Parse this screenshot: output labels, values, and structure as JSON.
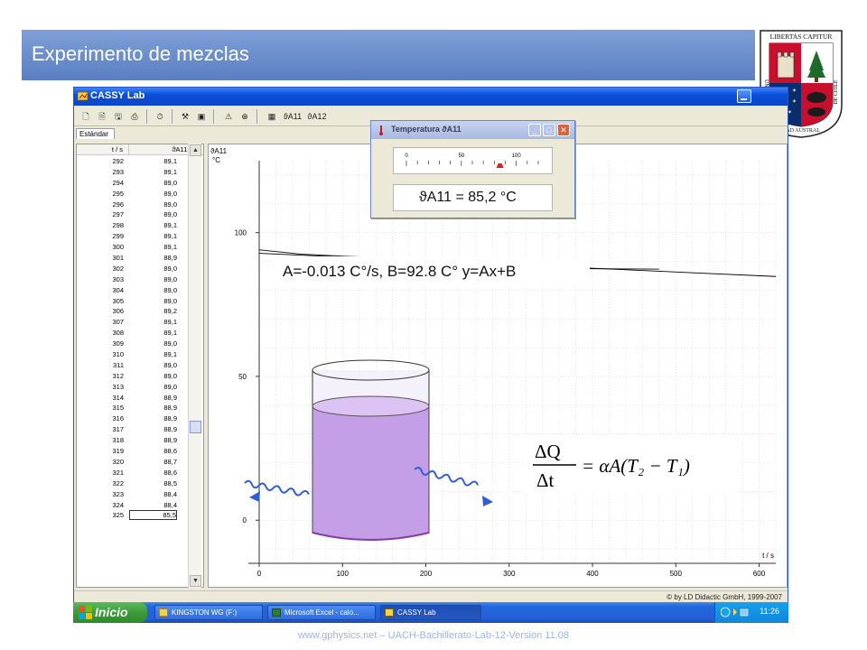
{
  "slide": {
    "title": "Experimento de mezclas",
    "footer": "www.gphysics.net – UACH-Bachillerato-Lab-12-Version 11.08",
    "seal_top_text": "LIBERTAS CAPITUR",
    "seal_left_text": "UNIVERSI",
    "seal_bottom_text": "DAD AUSTRAL",
    "seal_right_text": "DE CHILE"
  },
  "window": {
    "title": "CASSY Lab",
    "tab": "Estándar",
    "status": "© by LD Didactic GmbH, 1999-2007",
    "toolbar": {
      "a11": "ϑA11",
      "a12": "ϑA12"
    }
  },
  "table": {
    "col1": "t / s",
    "col2": "ϑA11 / °C",
    "rows": [
      [
        "292",
        "89,1"
      ],
      [
        "293",
        "89,1"
      ],
      [
        "294",
        "89,0"
      ],
      [
        "295",
        "89,0"
      ],
      [
        "296",
        "89,0"
      ],
      [
        "297",
        "89,0"
      ],
      [
        "298",
        "89,1"
      ],
      [
        "299",
        "89,1"
      ],
      [
        "300",
        "89,1"
      ],
      [
        "301",
        "88,9"
      ],
      [
        "302",
        "89,0"
      ],
      [
        "303",
        "89,0"
      ],
      [
        "304",
        "89,0"
      ],
      [
        "305",
        "89,0"
      ],
      [
        "306",
        "89,2"
      ],
      [
        "307",
        "89,1"
      ],
      [
        "308",
        "89,1"
      ],
      [
        "309",
        "89,0"
      ],
      [
        "310",
        "89,1"
      ],
      [
        "311",
        "89,0"
      ],
      [
        "312",
        "89,0"
      ],
      [
        "313",
        "89,0"
      ],
      [
        "314",
        "88,9"
      ],
      [
        "315",
        "88,9"
      ],
      [
        "316",
        "88,9"
      ],
      [
        "317",
        "88,9"
      ],
      [
        "318",
        "88,9"
      ],
      [
        "319",
        "88,6"
      ],
      [
        "320",
        "88,7"
      ],
      [
        "321",
        "88,6"
      ],
      [
        "322",
        "88,5"
      ],
      [
        "323",
        "88,4"
      ],
      [
        "324",
        "88,4"
      ],
      [
        "325",
        "85,5"
      ]
    ]
  },
  "chart_data": {
    "type": "line",
    "ylabel_top": "ϑA11",
    "ylabel_unit": "°C",
    "xlabel": "t / s",
    "xlim": [
      0,
      620
    ],
    "ylim": [
      -15,
      125
    ],
    "xticks": [
      0,
      100,
      200,
      300,
      400,
      500,
      600
    ],
    "yticks": [
      0,
      50,
      100
    ],
    "series": [
      {
        "x": [
          0,
          50,
          100,
          150,
          200,
          250,
          300,
          320,
          325,
          330,
          340,
          380,
          420,
          480
        ],
        "y": [
          94.0,
          92.5,
          91.8,
          91.3,
          90.8,
          90.0,
          89.1,
          88.7,
          85.5,
          87.6,
          87.6,
          87.5,
          87.4,
          87.3
        ],
        "color": "#222222"
      },
      {
        "x": [
          0,
          620
        ],
        "y": [
          92.8,
          84.74
        ],
        "color": "#000000"
      }
    ],
    "marker": {
      "x": 325,
      "y": 87.7,
      "color": "#3bb3d6"
    }
  },
  "temperature_window": {
    "title": "Temperatura ϑA11",
    "scale_labels": [
      "0",
      "50",
      "100"
    ],
    "scale_max": 120,
    "value_label": "ϑA11 =",
    "value": "85,2 °C",
    "needle_value": 85.2,
    "needle_color": "#e02020"
  },
  "annotations": {
    "fit": "A=-0.013 C°/s, B=92.8 C°  y=Ax+B",
    "formula_lhs_num": "ΔQ",
    "formula_lhs_den": "Δt",
    "formula_rhs": "= αA(T₂ − T₁)"
  },
  "taskbar": {
    "start": "Inicio",
    "tasks": [
      "KINGSTON WG (F:)",
      "Microsoft Excel - calo...",
      "CASSY Lab"
    ],
    "time": "11:26"
  },
  "colors": {
    "title_bar": "#5a7fc2",
    "liquid": "#c59ee8",
    "heat_arrow": "#2f5fd6"
  }
}
